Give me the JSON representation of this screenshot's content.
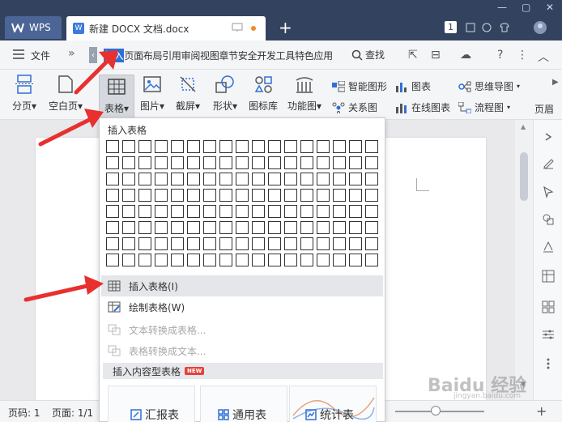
{
  "titlebar": {
    "wps_tab": "WPS",
    "doc_tab": "新建 DOCX 文档.docx",
    "badge_number": "1"
  },
  "menubar": {
    "file": "文件",
    "tabs": [
      "插入",
      "页面布局",
      "引用",
      "审阅",
      "视图",
      "章节",
      "安全",
      "开发工具",
      "特色应用"
    ],
    "search": "查找"
  },
  "ribbon": {
    "buttons": [
      {
        "label": "分页",
        "icon": "page-break-icon"
      },
      {
        "label": "空白页",
        "icon": "blank-page-icon"
      },
      {
        "label": "表格",
        "icon": "table-icon"
      },
      {
        "label": "图片",
        "icon": "picture-icon"
      },
      {
        "label": "截屏",
        "icon": "screenshot-icon"
      },
      {
        "label": "形状",
        "icon": "shape-icon"
      },
      {
        "label": "图标库",
        "icon": "icon-library-icon"
      },
      {
        "label": "功能图",
        "icon": "function-chart-icon"
      }
    ],
    "small": {
      "smart_graphic": "智能图形",
      "chart": "图表",
      "mind_map": "思维导图",
      "relation": "关系图",
      "online_chart": "在线图表",
      "flowchart": "流程图"
    },
    "page_label": "页眉"
  },
  "dropdown": {
    "header": "插入表格",
    "items": [
      {
        "label": "插入表格(I)",
        "icon": "insert-table-icon"
      },
      {
        "label": "绘制表格(W)",
        "icon": "draw-table-icon"
      },
      {
        "label": "文本转换成表格...",
        "icon": "text-to-table-icon"
      },
      {
        "label": "表格转换成文本...",
        "icon": "table-to-text-icon"
      }
    ],
    "section": "插入内容型表格",
    "section_badge": "NEW",
    "templates": [
      "汇报表",
      "通用表",
      "统计表"
    ]
  },
  "statusbar": {
    "page_num": "页码: 1",
    "pages": "页面: 1/1"
  },
  "watermark": {
    "main": "Baidu 经验",
    "sub": "jingyan.baidu.com"
  },
  "colors": {
    "titlebar": "#33435f",
    "accent": "#2f6fd8",
    "arrow": "#e8302f"
  }
}
